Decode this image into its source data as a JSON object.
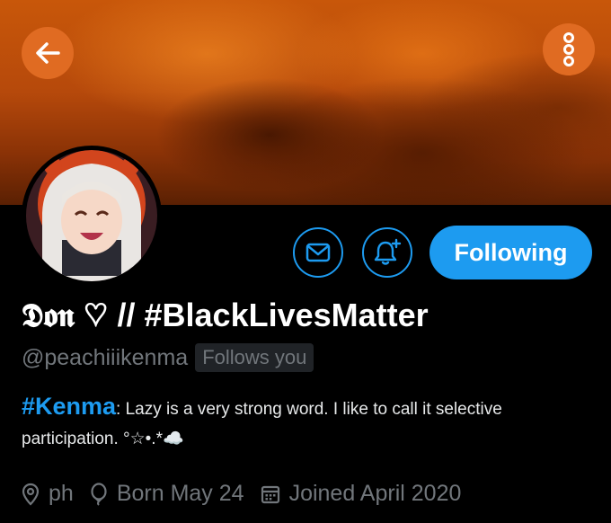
{
  "profile": {
    "display_name": "𝕯𝖔𝖓 ♡ // #BlackLivesMatter",
    "handle": "@peachiiikenma",
    "follows_badge": "Follows you",
    "bio_hashtag": "#Kenma",
    "bio_text": ": Lazy is a very strong word. I like to call it selective participation. °☆•.*☁️"
  },
  "actions": {
    "following_label": "Following"
  },
  "meta": {
    "location": "ph",
    "birthday": "Born May 24",
    "joined": "Joined April 2020"
  },
  "icons": {
    "back": "arrow-left-icon",
    "more": "more-vertical-icon",
    "message": "envelope-icon",
    "notify": "bell-plus-icon",
    "location": "location-pin-icon",
    "birthday": "balloon-icon",
    "calendar": "calendar-icon"
  },
  "colors": {
    "accent": "#1d9bf0",
    "banner_button": "#e06b22",
    "secondary_text": "#71767b",
    "background": "#000000"
  }
}
